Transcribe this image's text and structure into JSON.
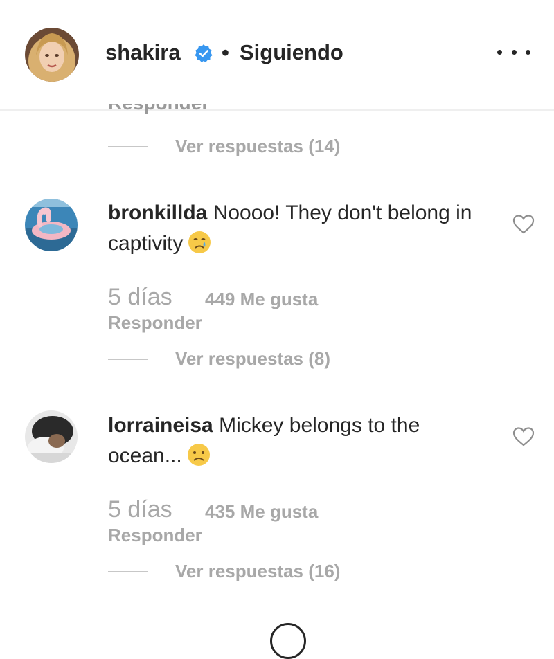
{
  "header": {
    "username": "shakira",
    "separator": "•",
    "follow_status": "Siguiendo",
    "verified_icon": "verified-badge-icon",
    "more_icon": "more-options-icon"
  },
  "top_thread": {
    "partial_text": "Responder",
    "view_replies": "Ver respuestas (14)"
  },
  "comments": [
    {
      "username": "bronkillda",
      "text": "Noooo! They don't belong in captivity",
      "emoji_icon": "crying-face-icon",
      "time": "5 días",
      "likes": "449 Me gusta",
      "reply": "Responder",
      "view_replies": "Ver respuestas (8)"
    },
    {
      "username": "lorraineisa",
      "text": "Mickey belongs to the ocean...",
      "emoji_icon": "sad-face-icon",
      "time": "5 días",
      "likes": "435 Me gusta",
      "reply": "Responder",
      "view_replies": "Ver respuestas (16)"
    }
  ],
  "colors": {
    "text": "#262626",
    "secondary": "#a8a8a8",
    "verified": "#3897f0",
    "divider": "#efefef"
  }
}
